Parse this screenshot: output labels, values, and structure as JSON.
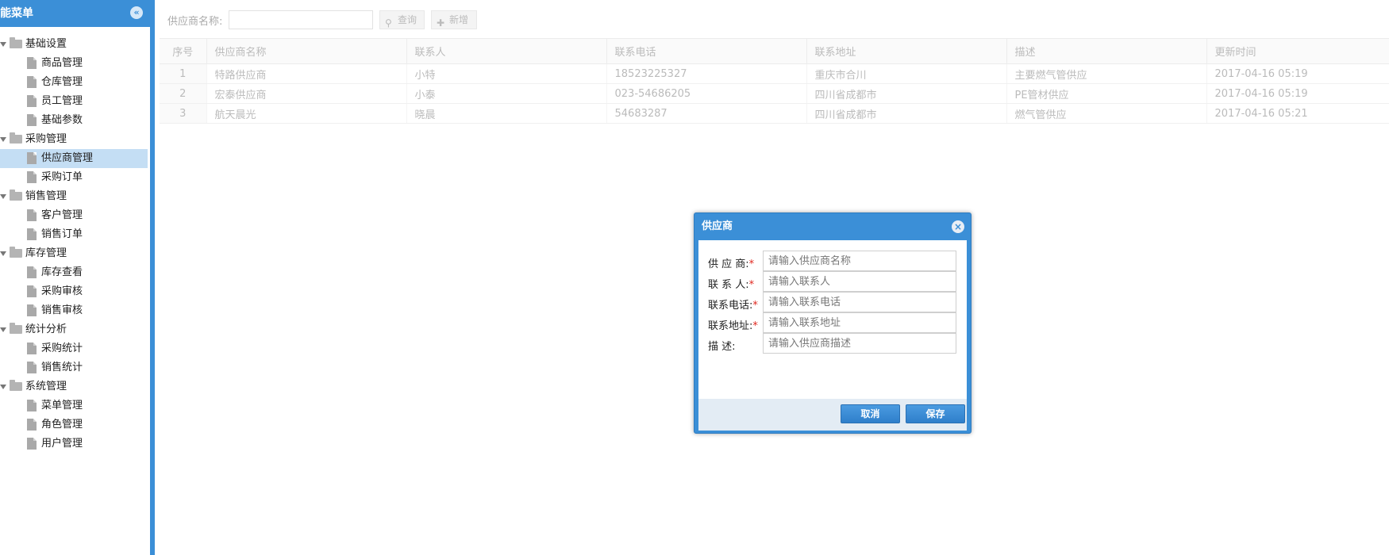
{
  "sidebar": {
    "title": "能菜单",
    "collapse_icon": "chevron-left-icon",
    "groups": [
      {
        "label": "基础设置",
        "items": [
          "商品管理",
          "仓库管理",
          "员工管理",
          "基础参数"
        ]
      },
      {
        "label": "采购管理",
        "items": [
          "供应商管理",
          "采购订单"
        ]
      },
      {
        "label": "销售管理",
        "items": [
          "客户管理",
          "销售订单"
        ]
      },
      {
        "label": "库存管理",
        "items": [
          "库存查看",
          "采购审核",
          "销售审核"
        ]
      },
      {
        "label": "统计分析",
        "items": [
          "采购统计",
          "销售统计"
        ]
      },
      {
        "label": "系统管理",
        "items": [
          "菜单管理",
          "角色管理",
          "用户管理"
        ]
      }
    ],
    "selected_item": "供应商管理"
  },
  "toolbar": {
    "search_label": "供应商名称:",
    "search_value": "",
    "query_label": "查询",
    "add_label": "新增"
  },
  "grid": {
    "columns": [
      "序号",
      "供应商名称",
      "联系人",
      "联系电话",
      "联系地址",
      "描述",
      "更新时间"
    ],
    "rows": [
      [
        "1",
        "特路供应商",
        "小特",
        "18523225327",
        "重庆市合川",
        "主要燃气管供应",
        "2017-04-16 05:19"
      ],
      [
        "2",
        "宏泰供应商",
        "小泰",
        "023-54686205",
        "四川省成都市",
        "PE管材供应",
        "2017-04-16 05:19"
      ],
      [
        "3",
        "航天晨光",
        "晓晨",
        "54683287",
        "四川省成都市",
        "燃气管供应",
        "2017-04-16 05:21"
      ]
    ]
  },
  "dialog": {
    "title": "供应商",
    "fields": [
      {
        "label": "供 应 商:",
        "required": true,
        "placeholder": "请输入供应商名称",
        "value": ""
      },
      {
        "label": "联 系 人:",
        "required": true,
        "placeholder": "请输入联系人",
        "value": ""
      },
      {
        "label": "联系电话:",
        "required": true,
        "placeholder": "请输入联系电话",
        "value": ""
      },
      {
        "label": "联系地址:",
        "required": true,
        "placeholder": "请输入联系地址",
        "value": ""
      },
      {
        "label": "描      述:",
        "required": false,
        "placeholder": "请输入供应商描述",
        "value": ""
      }
    ],
    "cancel_label": "取消",
    "save_label": "保存"
  },
  "colors": {
    "accent": "#3b8fd7",
    "selected_row": "#c4def4",
    "required_mark": "#e0281f"
  }
}
